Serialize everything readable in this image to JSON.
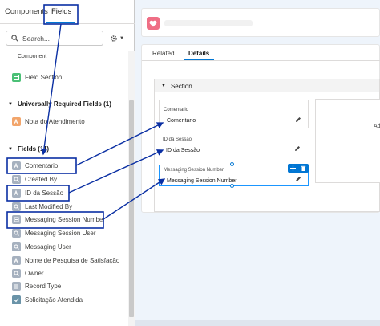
{
  "left_panel": {
    "tabs": {
      "components": "Components",
      "fields": "Fields"
    },
    "search": {
      "placeholder": "Search..."
    },
    "items": {
      "partial_top": "Component",
      "field_section": "Field Section",
      "universally_required_header": "Universally Required Fields (1)",
      "nota_do_atendimento": "Nota do Atendimento",
      "fields_header": "Fields (11)",
      "comentario": "Comentario",
      "created_by": "Created By",
      "id_da_sessao": "ID da Sessão",
      "last_modified_by": "Last Modified By",
      "messaging_session_number": "Messaging Session Number",
      "messaging_session_user": "Messaging Session User",
      "messaging_user": "Messaging User",
      "nome_de_pesquisa": "Nome de Pesquisa de Satisfação",
      "owner": "Owner",
      "record_type": "Record Type",
      "solicitacao_atendida": "Solicitação Atendida"
    }
  },
  "canvas": {
    "tabs": {
      "related": "Related",
      "details": "Details"
    },
    "section_title": "Section",
    "fields": [
      {
        "label": "Comentario",
        "value": "Comentario"
      },
      {
        "label": "ID da Sessão",
        "value": "ID da Sessão"
      },
      {
        "label": "Messaging Session Number",
        "value": "Messaging Session Number"
      }
    ],
    "add_text": "Ad"
  },
  "colors": {
    "annotation": "#0a2fa3",
    "brand_blue": "#0176d3",
    "record_icon": "#ef6e85"
  },
  "icons": [
    "search-icon",
    "gear-icon",
    "heart-icon",
    "pencil-icon",
    "move-icon",
    "trash-icon",
    "chevron-down-icon"
  ]
}
